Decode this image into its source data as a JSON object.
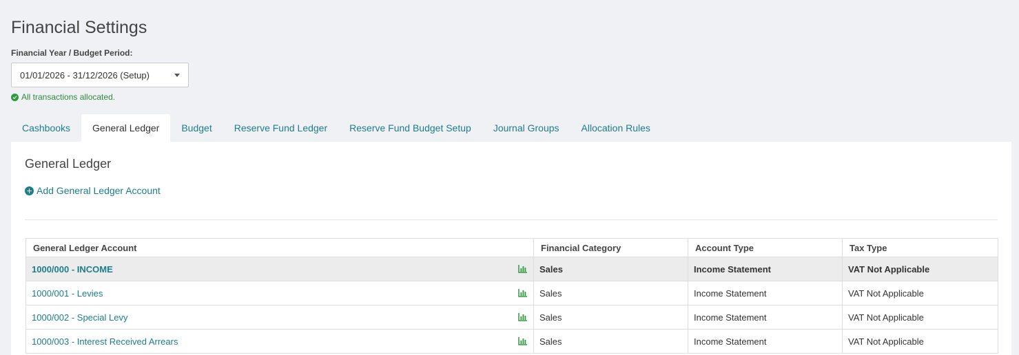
{
  "page": {
    "title": "Financial Settings"
  },
  "period": {
    "label": "Financial Year / Budget Period:",
    "selected": "01/01/2026 - 31/12/2026 (Setup)"
  },
  "status": {
    "text": "All transactions allocated.",
    "color": "#2e9a3e"
  },
  "tabs": [
    {
      "label": "Cashbooks",
      "active": false
    },
    {
      "label": "General Ledger",
      "active": true
    },
    {
      "label": "Budget",
      "active": false
    },
    {
      "label": "Reserve Fund Ledger",
      "active": false
    },
    {
      "label": "Reserve Fund Budget Setup",
      "active": false
    },
    {
      "label": "Journal Groups",
      "active": false
    },
    {
      "label": "Allocation Rules",
      "active": false
    }
  ],
  "panel": {
    "title": "General Ledger",
    "add_label": "Add General Ledger Account"
  },
  "table": {
    "headers": [
      "General Ledger Account",
      "Financial Category",
      "Account Type",
      "Tax Type"
    ],
    "rows": [
      {
        "account": "1000/000 - INCOME",
        "category": "Sales",
        "type": "Income Statement",
        "tax": "VAT Not Applicable",
        "parent": true,
        "icon": "bar-chart-icon"
      },
      {
        "account": "1000/001 - Levies",
        "category": "Sales",
        "type": "Income Statement",
        "tax": "VAT Not Applicable",
        "parent": false,
        "icon": "bar-chart-icon"
      },
      {
        "account": "1000/002 - Special Levy",
        "category": "Sales",
        "type": "Income Statement",
        "tax": "VAT Not Applicable",
        "parent": false,
        "icon": "bar-chart-icon"
      },
      {
        "account": "1000/003 - Interest Received Arrears",
        "category": "Sales",
        "type": "Income Statement",
        "tax": "VAT Not Applicable",
        "parent": false,
        "icon": "bar-chart-icon"
      }
    ]
  },
  "colors": {
    "accent": "#1c7d8c",
    "background": "#f0f1f5",
    "parent_row": "#ececed",
    "chart_icon": "#2e9a3e"
  }
}
